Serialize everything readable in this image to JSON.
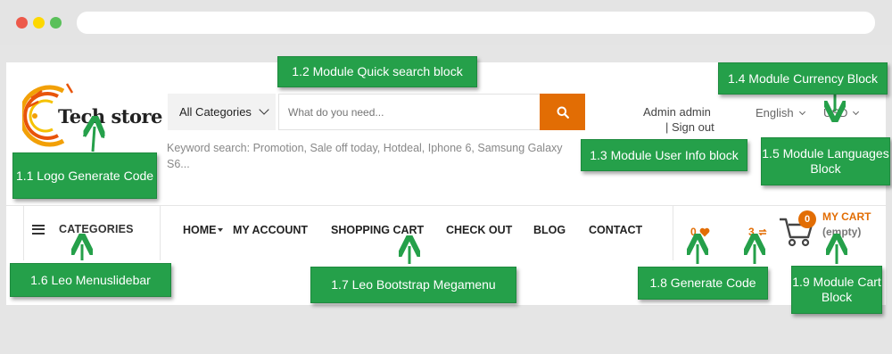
{
  "header": {
    "logo_text": "Tech store",
    "categories_select": "All Categories",
    "search_placeholder": "What do you need...",
    "keyword_search": "Keyword search: Promotion, Sale off today, Hotdeal, Iphone 6, Samsung Galaxy S6...",
    "user_name": "Admin admin",
    "sign_out": "| Sign out",
    "language": "English",
    "currency": "USD"
  },
  "nav": {
    "categories_label": "CATEGORIES",
    "menu": [
      "HOME",
      "MY ACCOUNT",
      "SHOPPING CART",
      "CHECK OUT",
      "BLOG",
      "CONTACT"
    ],
    "wishlist_count": "0",
    "compare_count": "3",
    "cart_count": "0",
    "cart_label": "MY CART",
    "cart_status": "(empty)"
  },
  "annotations": {
    "logo": "1.1 Logo Generate Code",
    "search": "1.2 Module Quick search block",
    "user_info": "1.3 Module User Info block",
    "currency": "1.4 Module Currency Block",
    "languages": "1.5 Module Languages Block",
    "menuslidebar": "1.6 Leo Menuslidebar",
    "megamenu": "1.7 Leo Bootstrap Megamenu",
    "generate_code": "1.8 Generate Code",
    "cart": "1.9 Module Cart Block"
  },
  "colors": {
    "accent": "#e26d04",
    "annotation": "#25a04a"
  }
}
